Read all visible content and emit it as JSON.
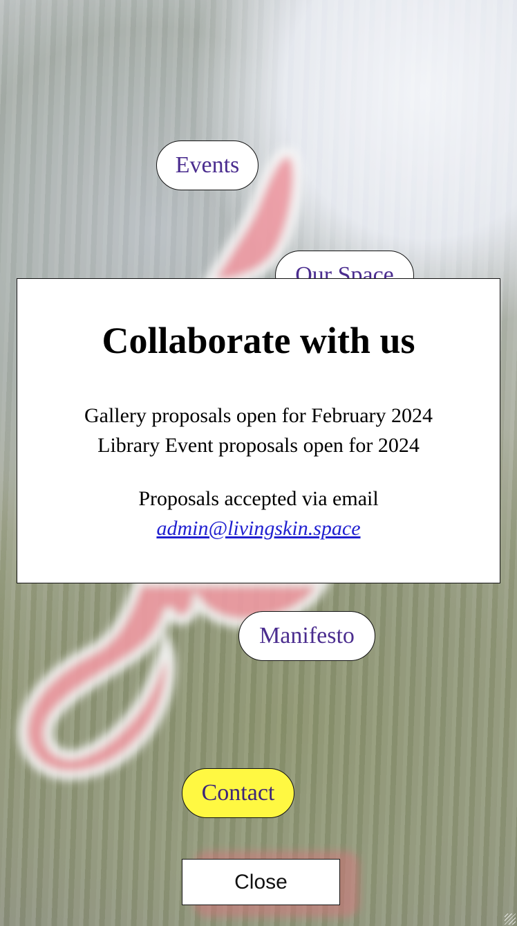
{
  "nav": {
    "events_label": "Events",
    "our_space_label": "Our Space",
    "manifesto_label": "Manifesto",
    "contact_label": "Contact"
  },
  "modal": {
    "title": "Collaborate with us",
    "line_1": "Gallery proposals open for February 2024",
    "line_2": "Library Event proposals open for 2024",
    "line_3": "Proposals accepted via email",
    "email": "admin@livingskin.space",
    "close_label": "Close"
  },
  "colors": {
    "nav_text": "#4b2d8f",
    "contact_bg": "#fff842",
    "link": "#2020d0",
    "blob": "#e58c95"
  }
}
